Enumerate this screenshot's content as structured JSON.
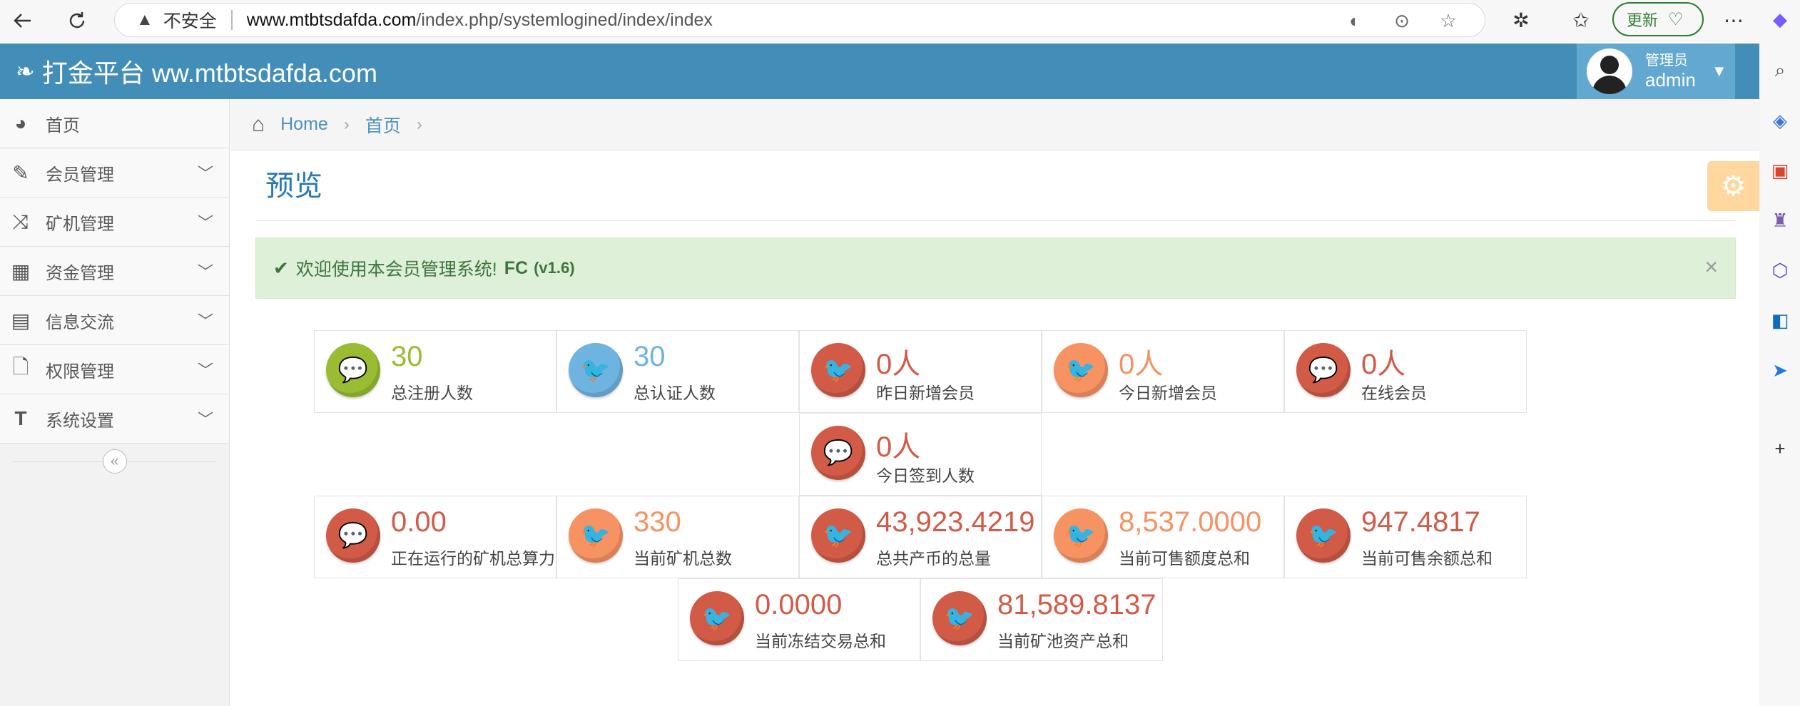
{
  "browser": {
    "insecure_label": "不安全",
    "url_host": "www.mtbtsdafda.com",
    "url_path": "/index.php/systemlogined/index/index",
    "update_label": "更新"
  },
  "header": {
    "brand": "打金平台 ww.mtbtsdafda.com",
    "user_role": "管理员",
    "user_name": "admin"
  },
  "sidebar": {
    "items": [
      {
        "label": "首页",
        "icon": "dashboard-icon"
      },
      {
        "label": "会员管理",
        "icon": "edit-icon"
      },
      {
        "label": "矿机管理",
        "icon": "shuffle-icon"
      },
      {
        "label": "资金管理",
        "icon": "calendar-icon"
      },
      {
        "label": "信息交流",
        "icon": "list-icon"
      },
      {
        "label": "权限管理",
        "icon": "file-icon"
      },
      {
        "label": "系统设置",
        "icon": "text-icon"
      }
    ]
  },
  "breadcrumb": {
    "home": "Home",
    "current": "首页"
  },
  "page": {
    "title": "预览"
  },
  "alert": {
    "message": "欢迎使用本会员管理系统!",
    "product": "FC",
    "version": "(v1.6)"
  },
  "stats": [
    {
      "value": "30",
      "label": "总注册人数",
      "color": "green",
      "icon": "comments-icon"
    },
    {
      "value": "30",
      "label": "总认证人数",
      "color": "blue",
      "icon": "twitter-icon"
    },
    {
      "value": "0人",
      "label": "昨日新增会员",
      "color": "red",
      "icon": "twitter-icon"
    },
    {
      "value": "0人",
      "label": "今日新增会员",
      "color": "orange",
      "icon": "twitter-icon"
    },
    {
      "value": "0人",
      "label": "在线会员",
      "color": "red",
      "icon": "comments-icon"
    },
    {
      "value": "0人",
      "label": "今日签到人数",
      "color": "red",
      "icon": "comments-icon"
    },
    {
      "value": "0.00",
      "label": "正在运行的矿机总算力",
      "color": "red",
      "icon": "comments-icon"
    },
    {
      "value": "330",
      "label": "当前矿机总数",
      "color": "orange",
      "icon": "twitter-icon"
    },
    {
      "value": "43,923.4219",
      "label": "总共产币的总量",
      "color": "red",
      "icon": "twitter-icon"
    },
    {
      "value": "8,537.0000",
      "label": "当前可售额度总和",
      "color": "orange",
      "icon": "twitter-icon"
    },
    {
      "value": "947.4817",
      "label": "当前可售余额总和",
      "color": "red",
      "icon": "twitter-icon"
    },
    {
      "value": "0.0000",
      "label": "当前冻结交易总和",
      "color": "red",
      "icon": "twitter-icon"
    },
    {
      "value": "81,589.8137",
      "label": "当前矿池资产总和",
      "color": "red",
      "icon": "twitter-icon"
    }
  ]
}
